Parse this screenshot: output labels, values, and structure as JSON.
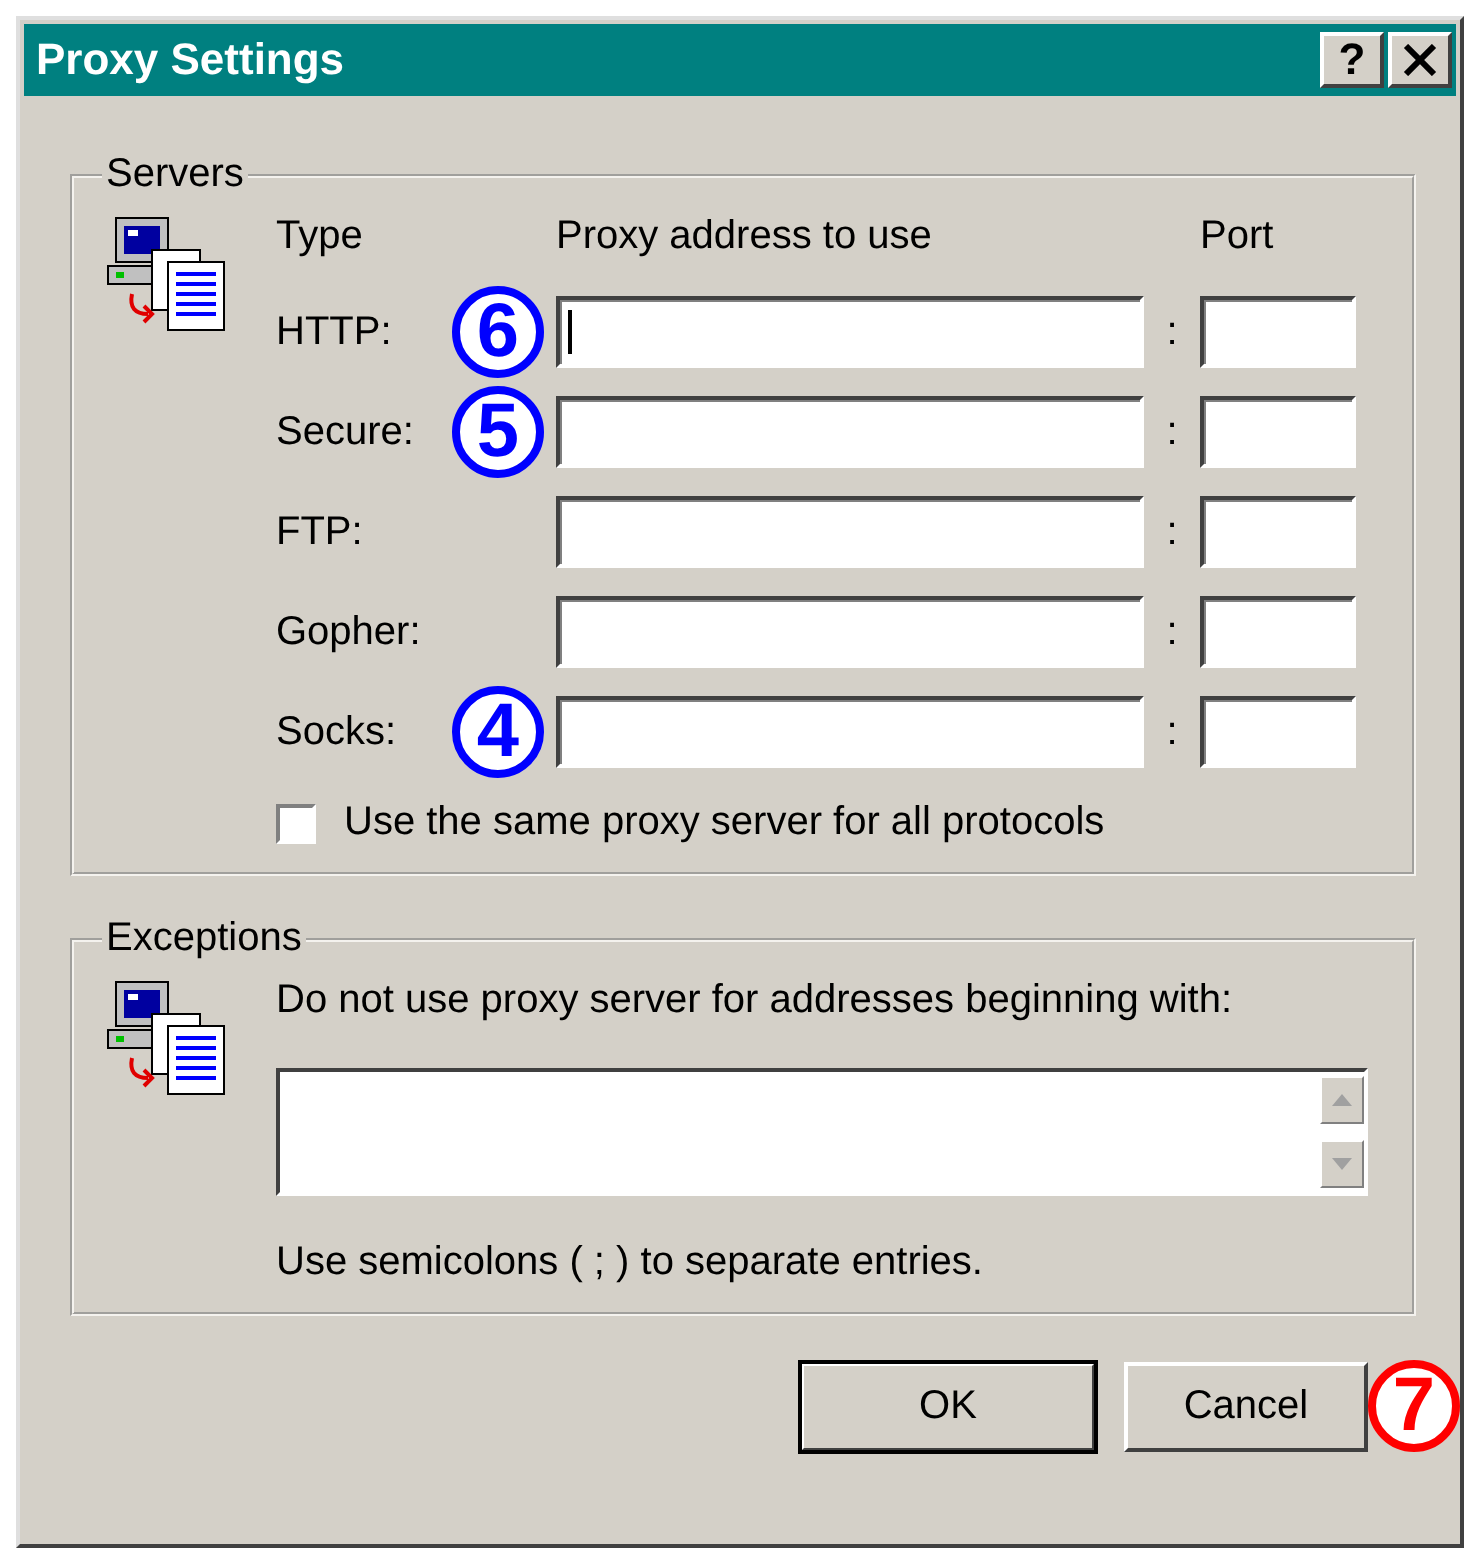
{
  "window": {
    "title": "Proxy Settings",
    "help_label": "?"
  },
  "servers": {
    "title": "Servers",
    "headers": {
      "type": "Type",
      "address": "Proxy address to use",
      "port": "Port"
    },
    "rows": [
      {
        "label": "HTTP:",
        "separator": ":",
        "focused": true,
        "callout": {
          "text": "6",
          "color": "#0000ff"
        }
      },
      {
        "label": "Secure:",
        "separator": ":",
        "focused": false,
        "callout": {
          "text": "5",
          "color": "#0000ff"
        }
      },
      {
        "label": "FTP:",
        "separator": ":",
        "focused": false
      },
      {
        "label": "Gopher:",
        "separator": ":",
        "focused": false
      },
      {
        "label": "Socks:",
        "separator": ":",
        "focused": false,
        "callout": {
          "text": "4",
          "color": "#0000ff"
        }
      }
    ],
    "same_proxy": {
      "label": "Use the same proxy server for all protocols",
      "checked": false
    }
  },
  "exceptions": {
    "title": "Exceptions",
    "prompt": "Do not use proxy server for addresses beginning with:",
    "hint": "Use semicolons ( ; ) to separate entries."
  },
  "buttons": [
    {
      "label": "OK",
      "default": true
    },
    {
      "label": "Cancel",
      "default": false,
      "callout": {
        "text": "7",
        "color": "#ff0000"
      }
    }
  ]
}
